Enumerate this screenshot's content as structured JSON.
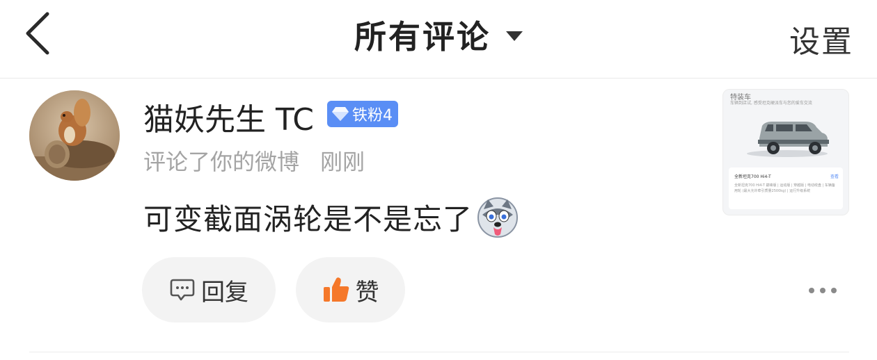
{
  "header": {
    "title": "所有评论",
    "settings_label": "设置",
    "back_icon": "chevron-left-icon",
    "dropdown_icon": "caret-down-icon"
  },
  "comment": {
    "username": "猫妖先生 TC",
    "badge": "铁粉4",
    "badge_icon": "diamond-icon",
    "action_text": "评论了你的微博",
    "time": "刚刚",
    "text": "可变截面涡轮是不是忘了",
    "emoji_icon": "husky-emoji-icon"
  },
  "thumbnail": {
    "top_text": "特装车",
    "sub_text": "车辆到店试, 感受坦克硬派车与您的爱车交流",
    "card_title": "全新坦克700 Hi4-T",
    "card_link": "查看",
    "card_desc": "全新坦克700 Hi4-T 巅峰版 | 运动版 | 穿越版 | 电动绞盘 | 车辆备用轮 (最大允许牵引质量2500kg) | 运行升级系统"
  },
  "actions": {
    "reply_label": "回复",
    "like_label": "赞",
    "reply_icon": "comment-bubble-icon",
    "like_icon": "thumbs-up-icon",
    "more_icon": "more-dots-icon"
  },
  "colors": {
    "badge": "#5a8ef5",
    "like_icon": "#f5782a",
    "secondary_text": "#a4a4a4"
  }
}
